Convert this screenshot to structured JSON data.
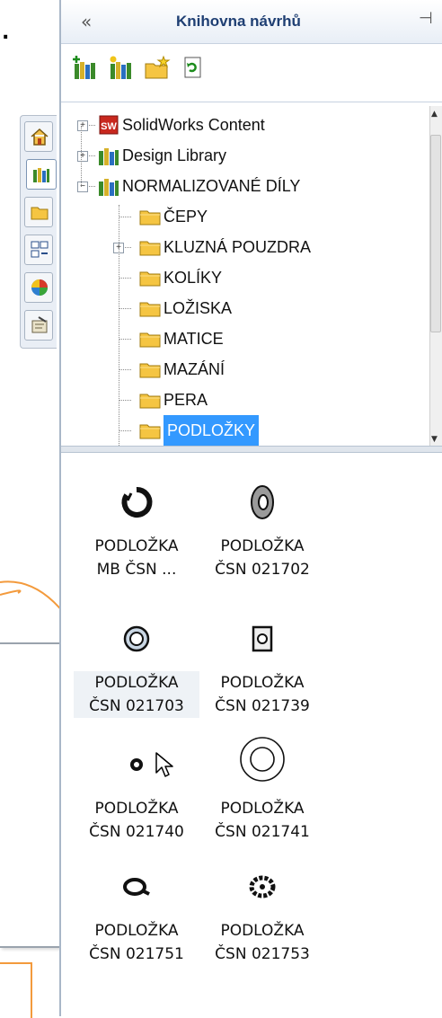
{
  "panel": {
    "title": "Knihovna návrhů",
    "collapse_glyph": "«",
    "pin_glyph": "⊣"
  },
  "left_dot": ".",
  "toolbar": [
    "add-to-library-icon",
    "add-file-location-icon",
    "new-folder-icon",
    "refresh-icon"
  ],
  "tabs": [
    "home-icon",
    "design-library-icon",
    "file-explorer-icon",
    "view-palette-icon",
    "appearances-icon",
    "custom-properties-icon"
  ],
  "tree": [
    {
      "label": "SolidWorks Content",
      "icon": "solidworks-content-icon",
      "expander": "+",
      "indent": 0
    },
    {
      "label": "Design Library",
      "icon": "library-icon",
      "expander": "+",
      "indent": 0
    },
    {
      "label": "NORMALIZOVANÉ DÍLY",
      "icon": "library-icon",
      "expander": "−",
      "indent": 0
    },
    {
      "label": "ČEPY",
      "icon": "folder-icon",
      "expander": "",
      "indent": 1
    },
    {
      "label": "KLUZNÁ POUZDRA",
      "icon": "folder-icon",
      "expander": "+",
      "indent": 1
    },
    {
      "label": "KOLÍKY",
      "icon": "folder-icon",
      "expander": "",
      "indent": 1
    },
    {
      "label": "LOŽISKA",
      "icon": "folder-icon",
      "expander": "",
      "indent": 1
    },
    {
      "label": "MATICE",
      "icon": "folder-icon",
      "expander": "",
      "indent": 1
    },
    {
      "label": "MAZÁNÍ",
      "icon": "folder-icon",
      "expander": "",
      "indent": 1
    },
    {
      "label": "PERA",
      "icon": "folder-icon",
      "expander": "",
      "indent": 1
    },
    {
      "label": "PODLOŽKY",
      "icon": "folder-icon",
      "expander": "",
      "indent": 1,
      "selected": true
    }
  ],
  "parts": [
    {
      "line1": "PODLOŽKA",
      "line2": "MB ČSN ...",
      "icon": "lock-washer-icon"
    },
    {
      "line1": "PODLOŽKA",
      "line2": "ČSN 021702",
      "icon": "flat-washer-icon"
    },
    {
      "line1": "PODLOŽKA",
      "line2": "ČSN 021703",
      "icon": "ring-washer-icon",
      "hover": true
    },
    {
      "line1": "PODLOŽKA",
      "line2": "ČSN 021739",
      "icon": "square-washer-icon"
    },
    {
      "line1": "PODLOŽKA",
      "line2": "ČSN 021740",
      "icon": "small-washer-icon"
    },
    {
      "line1": "PODLOŽKA",
      "line2": "ČSN 021741",
      "icon": "large-washer-icon"
    },
    {
      "line1": "PODLOŽKA",
      "line2": "ČSN 021751",
      "icon": "tab-washer-icon"
    },
    {
      "line1": "PODLOŽKA",
      "line2": "ČSN 021753",
      "icon": "toothed-washer-icon"
    }
  ],
  "colors": {
    "selection": "#3399ff",
    "callout_orange": "#f39a3c",
    "title": "#1f3f73"
  }
}
